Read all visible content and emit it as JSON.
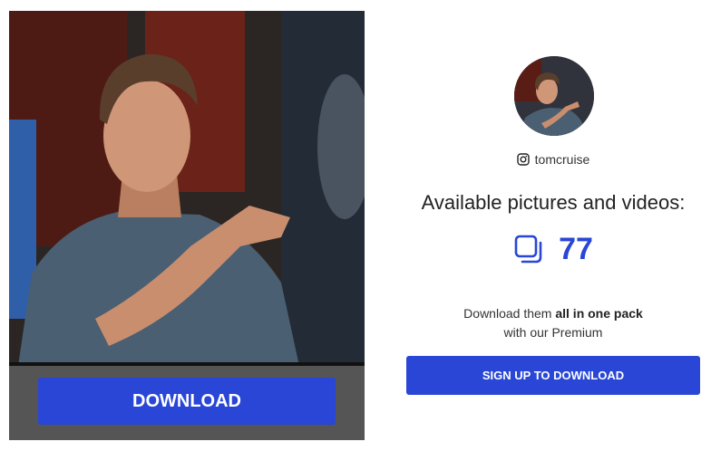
{
  "photo": {
    "alt": "Profile photo"
  },
  "download_button": {
    "label": "DOWNLOAD"
  },
  "profile": {
    "handle": "tomcruise",
    "handle_icon": "instagram-icon"
  },
  "headline": "Available pictures and videos:",
  "media": {
    "count": "77",
    "icon": "gallery-icon"
  },
  "promo": {
    "prefix": "Download them ",
    "emphasis": "all in one pack",
    "suffix": "with our Premium"
  },
  "signup_button": {
    "label": "SIGN UP TO DOWNLOAD"
  },
  "colors": {
    "accent": "#2946d6",
    "panel_gray": "#555555"
  }
}
